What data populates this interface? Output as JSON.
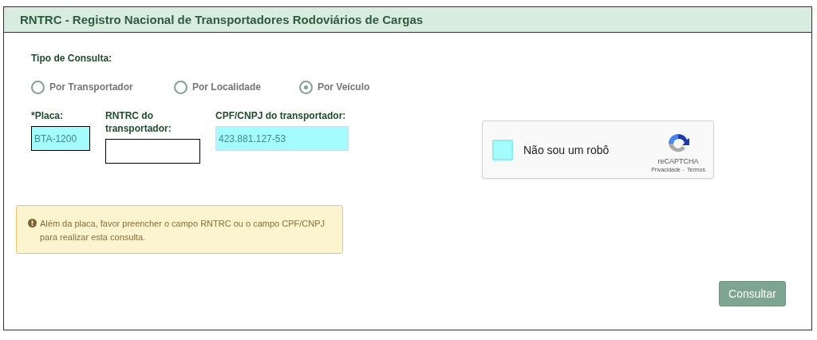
{
  "panel": {
    "title": "RNTRC - Registro Nacional de Transportadores Rodoviários de Cargas"
  },
  "query_type": {
    "label": "Tipo de Consulta:",
    "options": [
      {
        "label": "Por Transportador",
        "selected": false
      },
      {
        "label": "Por Localidade",
        "selected": false
      },
      {
        "label": "Por Veículo",
        "selected": true
      }
    ]
  },
  "fields": [
    {
      "label": "*Placa:",
      "value": "BTA-1200",
      "highlighted": true,
      "focused": false
    },
    {
      "label": "RNTRC do transportador:",
      "highlighted": false,
      "focused": false
    },
    {
      "label": "CPF/CNPJ do transportador:",
      "value": "423.881.127-53",
      "highlighted": true,
      "focused": true
    }
  ],
  "captcha": {
    "label": "Não sou um robô",
    "checked": false,
    "brand": "reCAPTCHA",
    "links": [
      "Privacidade",
      "Termos"
    ],
    "separator": "-"
  },
  "alert": {
    "text": "Além da placa, favor preencher o campo RNTRC ou o campo CPF/CNPJ para realizar esta consulta."
  },
  "buttons": [
    "Consultar"
  ]
}
